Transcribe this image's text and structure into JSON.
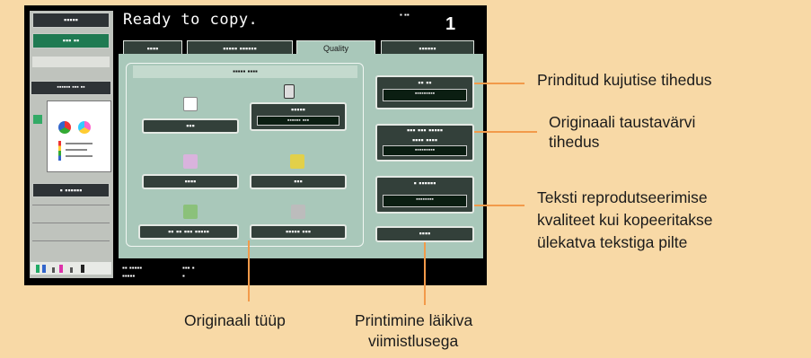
{
  "screen": {
    "title": "Ready to copy.",
    "counter": "1",
    "corner_badge": "▪ ▪▪",
    "sidebar": {
      "button_top": "▪▪▪▪▪",
      "button_selected": "▪▪▪ ▪▪",
      "doc_label": "▪▪▪▪▪▪ ▪▪▪ ▪▪",
      "check_button": "▪ ▪▪▪▪▪▪"
    },
    "tabs": [
      "▪▪▪▪",
      "▪▪▪▪▪ ▪▪▪▪▪▪",
      "Quality",
      "▪▪▪▪▪▪"
    ],
    "group_title": "▪▪▪▪▪ ▪▪▪▪",
    "original_types": [
      {
        "label": "▪▪▪",
        "icon": "text-doc-icon"
      },
      {
        "label": "▪▪▪▪▪",
        "sub": "▪▪▪▪▪▪ ▪▪▪",
        "icon": "printed-photo-icon"
      },
      {
        "label": "▪▪▪▪",
        "icon": "photo-icon"
      },
      {
        "label": "▪▪▪",
        "icon": "map-icon"
      },
      {
        "label": "▪▪ ▪▪ ▪▪▪ ▪▪▪▪▪",
        "icon": "pencil-icon"
      },
      {
        "label": "▪▪▪▪▪ ▪▪▪",
        "icon": "copy-icon"
      }
    ],
    "right_buttons": {
      "density_label": "▪▪ ▪▪",
      "density_value": "▪▪▪▪▪▪▪▪▪",
      "bg_label": "▪▪▪ ▪▪▪ ▪▪▪▪▪",
      "bg_label2": "▪▪▪▪ ▪▪▪▪",
      "bg_value": "▪▪▪▪▪▪▪▪▪",
      "text_label": "▪ ▪▪▪▪▪▪",
      "text_value": "▪▪▪▪▪▪▪▪",
      "glossy_label": "▪▪▪▪"
    },
    "status_bar": {
      "line1": "▪▪ ▪▪▪▪▪",
      "line2": "▪▪▪▪▪",
      "val1": "▪▪▪ ▪",
      "val2": "▪"
    }
  },
  "annotations": {
    "print_density": "Prinditud kujutise tihedus",
    "bg_density_1": "Originaali taustavärvi",
    "bg_density_2": "tihedus",
    "text_quality_1": "Teksti reprodutseerimise",
    "text_quality_2": "kvaliteet kui kopeeritakse",
    "text_quality_3": "ülekatva tekstiga pilte",
    "original_type": "Originaali tüüp",
    "glossy_1": "Printimine läikiva",
    "glossy_2": "viimistlusega"
  },
  "colors": {
    "background": "#f8d9a6",
    "panel": "#a9c8ba",
    "leader_line": "#f29a4a"
  }
}
